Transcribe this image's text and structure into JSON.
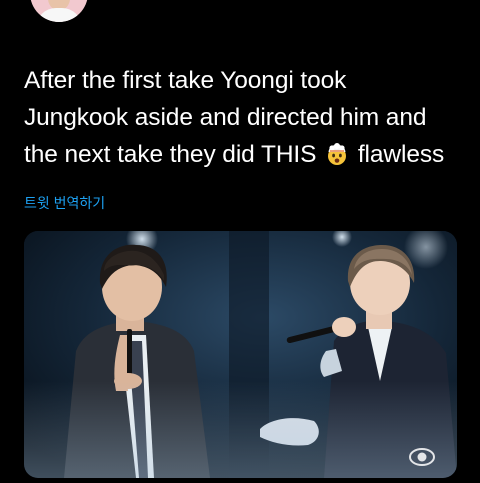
{
  "author": {
    "avatar_icon": "user-avatar"
  },
  "tweet": {
    "line1": "After the first take Yoongi took",
    "line2": "Jungkook aside and directed him and",
    "line3_before": "the next take they did THIS",
    "line3_emoji": "exploding-head-emoji",
    "line3_after": "flawless"
  },
  "translate_label": "트윗 번역하기",
  "media": {
    "type": "video-still",
    "watermark_icon": "cbs-eye-logo"
  },
  "colors": {
    "background": "#000000",
    "text": "#ffffff",
    "link": "#1da1f2"
  }
}
